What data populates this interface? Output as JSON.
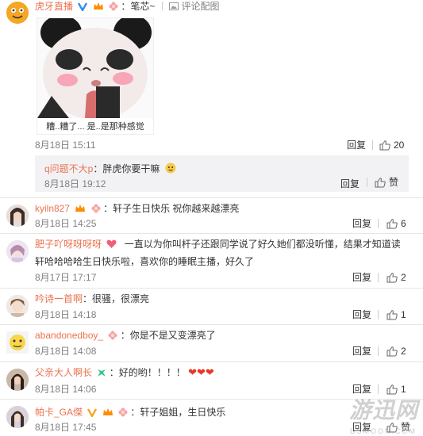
{
  "comments": [
    {
      "user": "虎牙直播",
      "sep": "：",
      "text": "笔芯~",
      "tools": "评论配图",
      "date": "8月18日 15:11",
      "reply": "回复",
      "likes": "20",
      "image_caption": "糟..糟了...  是..是那种感觉"
    },
    {
      "user": "kyiln827",
      "sep": "：",
      "text": "轩子生日快乐 祝你越来越漂亮",
      "date": "8月18日 14:25",
      "reply": "回复",
      "likes": "6"
    },
    {
      "user": "肥子吖呀呀呀呀",
      "sep": "",
      "text": "一直以为你叫杆子还跟同学说了好久她们都没听懂，结果才知道读",
      "text2": "轩哈哈哈哈生日快乐啦，喜欢你的睡眠主播，好久了",
      "date": "8月17日 17:17",
      "reply": "回复",
      "likes": "2"
    },
    {
      "user": "吟诗一首啊",
      "sep": "：",
      "text": "很骚，很漂亮",
      "date": "8月18日 14:18",
      "reply": "回复",
      "likes": "1"
    },
    {
      "user": "abandonedboy_",
      "sep": "：",
      "text": "你是不是又变漂亮了",
      "date": "8月18日 14:08",
      "reply": "回复",
      "likes": "2"
    },
    {
      "user": "父亲大人啊长",
      "sep": "：",
      "text": "好的哟！！！！",
      "date": "8月18日 14:06",
      "reply": "回复",
      "likes": "1"
    },
    {
      "user": "帕卡_GA傑",
      "sep": "：",
      "text": "轩子姐姐，生日快乐",
      "date": "8月18日 17:45",
      "reply": "回复",
      "likes": "赞"
    }
  ],
  "subreply": {
    "user": "q问题不大p",
    "text": "：胖虎你要干嘛",
    "date": "8月18日 19:12",
    "reply": "回复",
    "likes": "赞"
  },
  "watermark": "游迅网",
  "watermark_url": "DSMOON.COM",
  "colors": {
    "username": "#eb7350",
    "date": "#808080",
    "separator": "#e6e6e6",
    "subbox": "#f2f2f5"
  }
}
